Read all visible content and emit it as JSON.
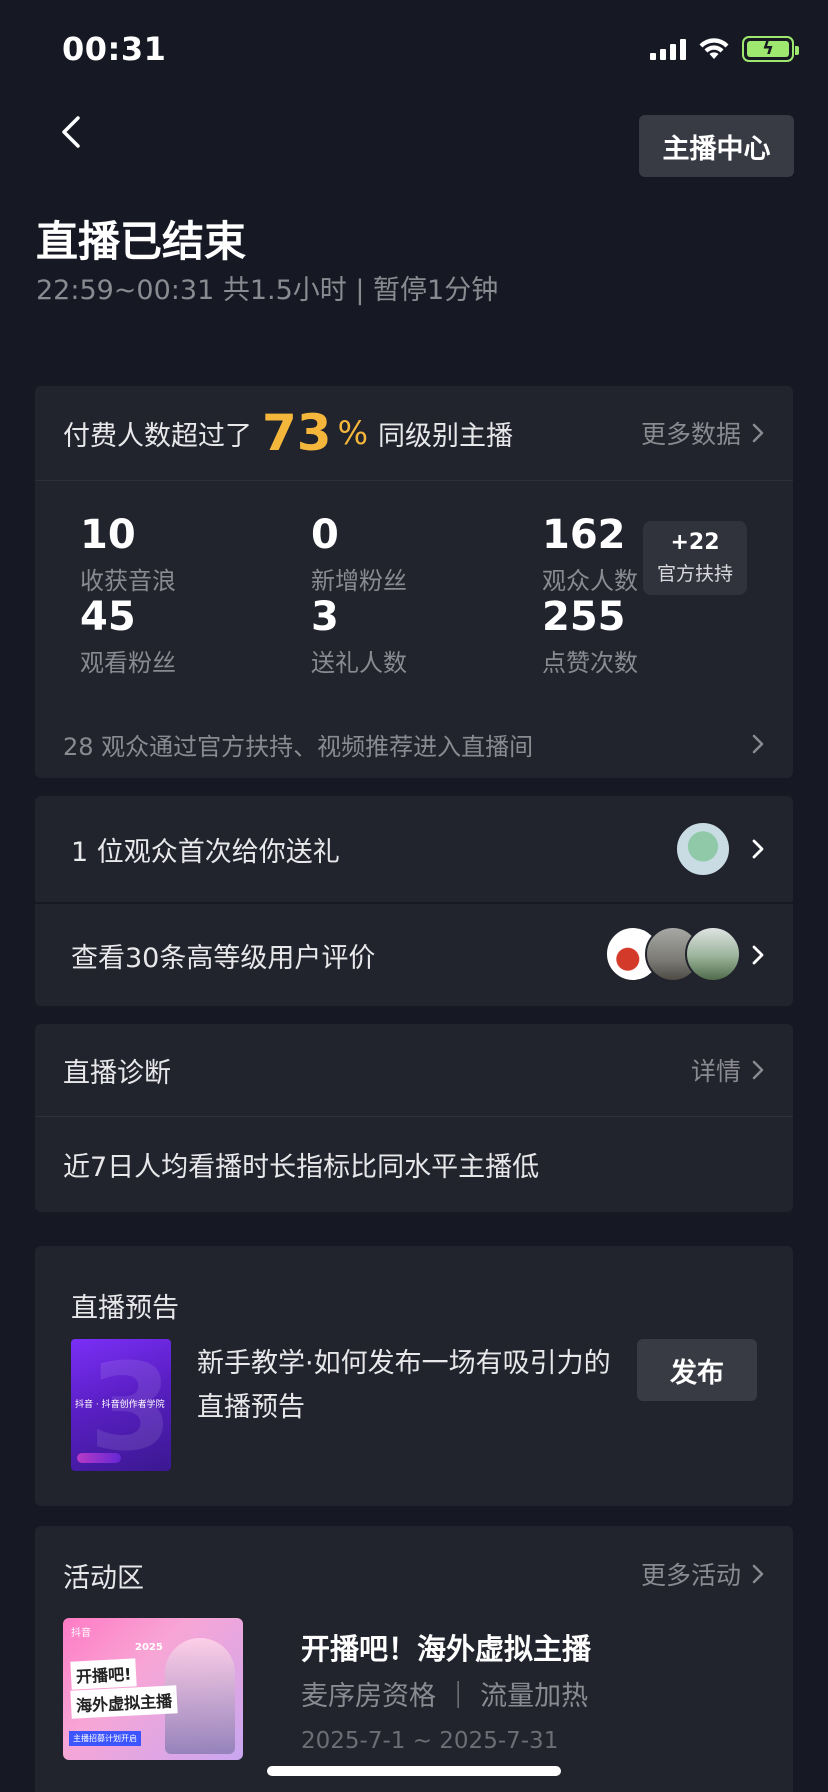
{
  "status_bar": {
    "time": "00:31"
  },
  "header": {
    "anchor_center_label": "主播中心",
    "title": "直播已结束",
    "subtitle": "22:59~00:31 共1.5小时 | 暂停1分钟"
  },
  "summary": {
    "prefix": "付费人数超过了",
    "percent": "73",
    "percent_sign": "%",
    "suffix": "同级别主播",
    "more_label": "更多数据",
    "stats": [
      {
        "value": "10",
        "label": "收获音浪"
      },
      {
        "value": "0",
        "label": "新增粉丝"
      },
      {
        "value": "162",
        "label": "观众人数"
      },
      {
        "value": "45",
        "label": "观看粉丝"
      },
      {
        "value": "3",
        "label": "送礼人数"
      },
      {
        "value": "255",
        "label": "点赞次数"
      }
    ],
    "boost": {
      "value": "+22",
      "label": "官方扶持"
    },
    "footer": "28 观众通过官方扶持、视频推荐进入直播间"
  },
  "gift_row": {
    "label": "1 位观众首次给你送礼"
  },
  "review_row": {
    "label": "查看30条高等级用户评价"
  },
  "diagnosis": {
    "title": "直播诊断",
    "detail_label": "详情",
    "body": "近7日人均看播时长指标比同水平主播低"
  },
  "preview": {
    "title": "直播预告",
    "thumb_label": "抖音 · 抖音创作者学院",
    "thumb_digit": "3",
    "description": "新手教学·如何发布一场有吸引力的直播预告",
    "publish_label": "发布"
  },
  "activity": {
    "title": "活动区",
    "more_label": "更多活动",
    "banner": {
      "logo": "抖音",
      "year": "2025",
      "line1": "开播吧!",
      "line2": "海外虚拟主播",
      "tag": "主播招募计划开启"
    },
    "name": "开播吧！海外虚拟主播",
    "subtitle": "麦序房资格 ｜ 流量加热",
    "date": "2025-7-1 ~ 2025-7-31"
  },
  "icons": {
    "back": "back-chevron-icon",
    "row_chevron": "chevron-right-icon",
    "signal": "cellular-signal-icon",
    "wifi": "wifi-icon",
    "battery": "battery-charging-icon"
  },
  "colors": {
    "background": "#161823",
    "card": "#21232d",
    "accent_percent": "#f5b73b",
    "button": "#393b44",
    "battery": "#9fe870"
  }
}
